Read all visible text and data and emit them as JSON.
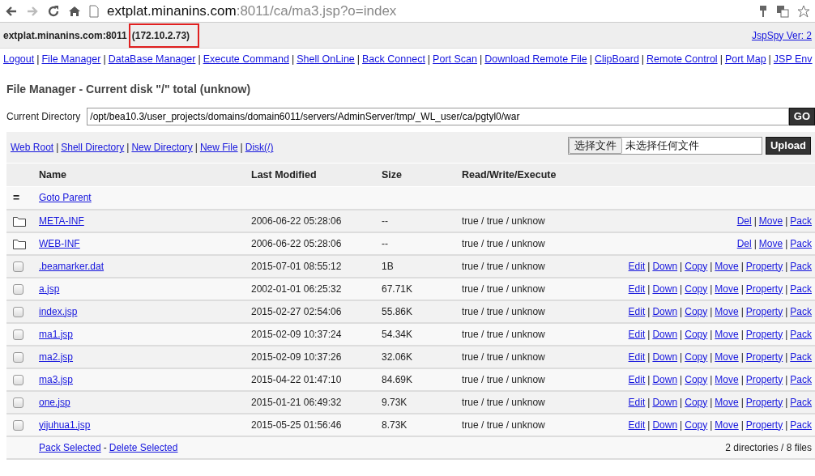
{
  "browser": {
    "url_host": "extplat.minanins.com",
    "url_rest": ":8011/ca/ma3.jsp?o=index"
  },
  "header": {
    "host": "extplat.minanins.com:8011",
    "ip": "(172.10.2.73)",
    "ip_highlighted": true,
    "version": "JspSpy Ver: 2"
  },
  "link_separator": "|",
  "nav": [
    "Logout",
    "File Manager",
    "DataBase Manager",
    "Execute Command",
    "Shell OnLine",
    "Back Connect",
    "Port Scan",
    "Download Remote File",
    "ClipBoard",
    "Remote Control",
    "Port Map",
    "JSP Env"
  ],
  "title": "File Manager - Current disk \"/\" total (unknow)",
  "current_directory": {
    "label": "Current Directory",
    "value": "/opt/bea10.3/user_projects/domains/domain6011/servers/AdminServer/tmp/_WL_user/ca/pgtyl0/war",
    "button": "GO"
  },
  "toolbar": {
    "links": [
      "Web Root",
      "Shell Directory",
      "New Directory",
      "New File",
      "Disk(/)"
    ],
    "file_button": "选择文件",
    "file_status": "未选择任何文件",
    "upload": "Upload"
  },
  "table": {
    "columns": [
      "Name",
      "Last Modified",
      "Size",
      "Read/Write/Execute"
    ],
    "parent": {
      "icon": "=",
      "label": "Goto Parent"
    },
    "rows": [
      {
        "kind": "folder",
        "name": "META-INF",
        "modified": "2006-06-22 05:28:06",
        "size": "--",
        "rwe": "true / true / unknow",
        "actions": [
          "Del",
          "Move",
          "Pack"
        ]
      },
      {
        "kind": "folder",
        "name": "WEB-INF",
        "modified": "2006-06-22 05:28:06",
        "size": "--",
        "rwe": "true / true / unknow",
        "actions": [
          "Del",
          "Move",
          "Pack"
        ]
      },
      {
        "kind": "file",
        "checked": false,
        "name": ".beamarker.dat",
        "modified": "2015-07-01 08:55:12",
        "size": "1B",
        "rwe": "true / true / unknow",
        "actions": [
          "Edit",
          "Down",
          "Copy",
          "Move",
          "Property",
          "Pack"
        ]
      },
      {
        "kind": "file",
        "checked": false,
        "name": "a.jsp",
        "modified": "2002-01-01 06:25:32",
        "size": "67.71K",
        "rwe": "true / true / unknow",
        "actions": [
          "Edit",
          "Down",
          "Copy",
          "Move",
          "Property",
          "Pack"
        ]
      },
      {
        "kind": "file",
        "checked": false,
        "name": "index.jsp",
        "modified": "2015-02-27 02:54:06",
        "size": "55.86K",
        "rwe": "true / true / unknow",
        "actions": [
          "Edit",
          "Down",
          "Copy",
          "Move",
          "Property",
          "Pack"
        ]
      },
      {
        "kind": "file",
        "checked": false,
        "name": "ma1.jsp",
        "modified": "2015-02-09 10:37:24",
        "size": "54.34K",
        "rwe": "true / true / unknow",
        "actions": [
          "Edit",
          "Down",
          "Copy",
          "Move",
          "Property",
          "Pack"
        ]
      },
      {
        "kind": "file",
        "checked": false,
        "name": "ma2.jsp",
        "modified": "2015-02-09 10:37:26",
        "size": "32.06K",
        "rwe": "true / true / unknow",
        "actions": [
          "Edit",
          "Down",
          "Copy",
          "Move",
          "Property",
          "Pack"
        ]
      },
      {
        "kind": "file",
        "checked": false,
        "name": "ma3.jsp",
        "modified": "2015-04-22 01:47:10",
        "size": "84.69K",
        "rwe": "true / true / unknow",
        "actions": [
          "Edit",
          "Down",
          "Copy",
          "Move",
          "Property",
          "Pack"
        ]
      },
      {
        "kind": "file",
        "checked": false,
        "name": "one.jsp",
        "modified": "2015-01-21 06:49:32",
        "size": "9.73K",
        "rwe": "true / true / unknow",
        "actions": [
          "Edit",
          "Down",
          "Copy",
          "Move",
          "Property",
          "Pack"
        ]
      },
      {
        "kind": "file",
        "checked": false,
        "name": "yijuhua1.jsp",
        "modified": "2015-05-25 01:56:46",
        "size": "8.73K",
        "rwe": "true / true / unknow",
        "actions": [
          "Edit",
          "Down",
          "Copy",
          "Move",
          "Property",
          "Pack"
        ]
      }
    ],
    "footer": {
      "actions": [
        "Pack Selected",
        "Delete Selected"
      ],
      "separator": "-",
      "summary": "2 directories / 8 files"
    }
  }
}
